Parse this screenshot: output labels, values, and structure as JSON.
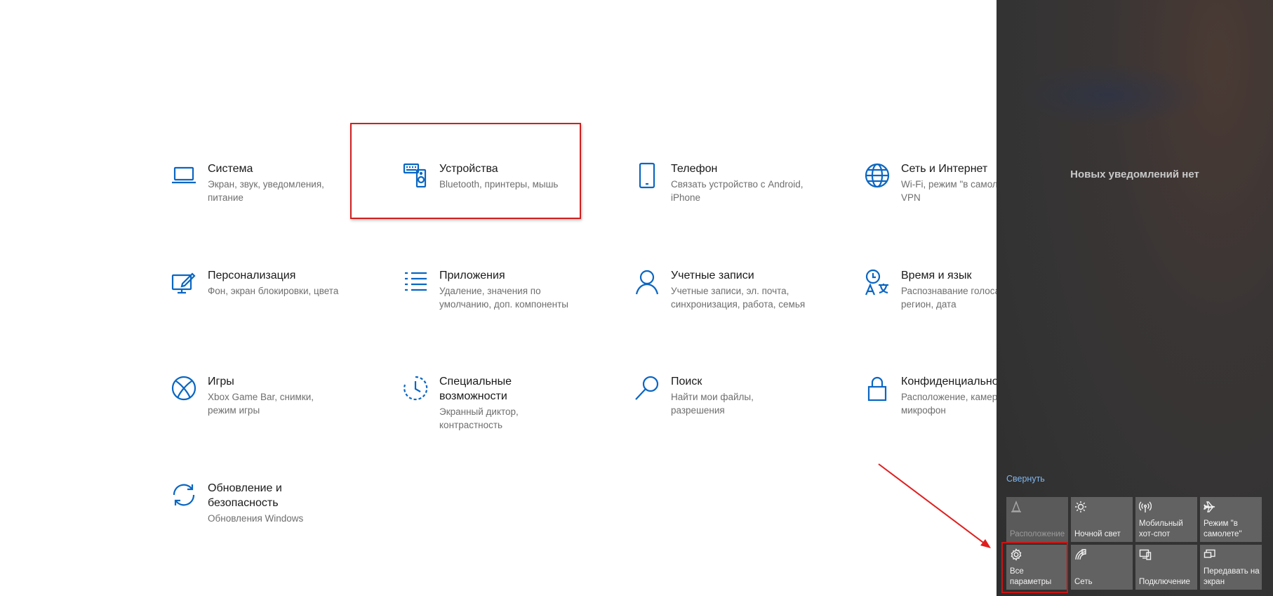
{
  "settings": {
    "tiles": [
      {
        "title": "Система",
        "desc": "Экран, звук, уведомления,\nпитание",
        "icon": "laptop-icon"
      },
      {
        "title": "Устройства",
        "desc": "Bluetooth, принтеры, мышь",
        "icon": "devices-icon"
      },
      {
        "title": "Телефон",
        "desc": "Связать устройство с Android,\niPhone",
        "icon": "phone-icon"
      },
      {
        "title": "Сеть и Интернет",
        "desc": "Wi-Fi, режим \"в самолете\",\nVPN",
        "icon": "globe-icon"
      },
      {
        "title": "Персонализация",
        "desc": "Фон, экран блокировки, цвета",
        "icon": "personalization-icon"
      },
      {
        "title": "Приложения",
        "desc": "Удаление, значения по\nумолчанию, доп. компоненты",
        "icon": "apps-list-icon"
      },
      {
        "title": "Учетные записи",
        "desc": "Учетные записи, эл. почта,\nсинхронизация, работа, семья",
        "icon": "person-icon"
      },
      {
        "title": "Время и язык",
        "desc": "Распознавание голоса,\nрегион, дата",
        "icon": "time-language-icon"
      },
      {
        "title": "Игры",
        "desc": "Xbox Game Bar, снимки,\nрежим игры",
        "icon": "xbox-icon"
      },
      {
        "title": "Специальные\nвозможности",
        "desc": "Экранный диктор,\nконтрастность",
        "icon": "ease-of-access-icon"
      },
      {
        "title": "Поиск",
        "desc": "Найти мои файлы,\nразрешения",
        "icon": "search-icon"
      },
      {
        "title": "Конфиденциальность",
        "desc": "Расположение, камера,\nмикрофон",
        "icon": "lock-icon"
      },
      {
        "title": "Обновление и\nбезопасность",
        "desc": "Обновления Windows",
        "icon": "sync-icon"
      }
    ]
  },
  "action_center": {
    "no_notifications": "Новых уведомлений нет",
    "collapse": "Свернуть",
    "quick_actions": [
      {
        "label": "Расположение",
        "icon": "location-icon",
        "dim": true
      },
      {
        "label": "Ночной свет",
        "icon": "brightness-icon",
        "dim": false
      },
      {
        "label": "Мобильный\nхот-спот",
        "icon": "hotspot-icon",
        "dim": false
      },
      {
        "label": "Режим \"в\nсамолете\"",
        "icon": "airplane-icon",
        "dim": false
      },
      {
        "label": "Все\nпараметры",
        "icon": "gear-icon",
        "dim": false
      },
      {
        "label": "Сеть",
        "icon": "network-icon",
        "dim": false
      },
      {
        "label": "Подключение",
        "icon": "connect-icon",
        "dim": false
      },
      {
        "label": "Передавать на\nэкран",
        "icon": "project-icon",
        "dim": false
      }
    ]
  },
  "colors": {
    "accent": "#0a66c2",
    "highlight": "#d11f1f",
    "tile_bg": "#626262"
  }
}
